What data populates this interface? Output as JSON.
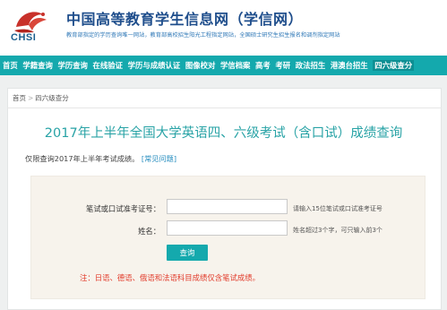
{
  "header": {
    "logo_text": "CHSI",
    "site_title": "中国高等教育学生信息网（学信网）",
    "site_subtitle": "教育部指定的学历查询唯一网站，教育部高校招生阳光工程指定网站，全国硕士研究生招生报名和调剂指定网站"
  },
  "nav": {
    "items": [
      "首页",
      "学籍查询",
      "学历查询",
      "在线验证",
      "学历与成绩认证",
      "图像校对",
      "学信档案",
      "高考",
      "考研",
      "政法招生",
      "港澳台招生",
      "四六级查分"
    ]
  },
  "breadcrumb": {
    "home": "首页",
    "separator": ">",
    "current": "四六级查分"
  },
  "main": {
    "title": "2017年上半年全国大学英语四、六级考试（含口试）成绩查询",
    "notice": "仅限查询2017年上半年考试成绩。",
    "faq_link": "[常见问题]"
  },
  "form": {
    "id_label": "笔试或口试准考证号：",
    "id_value": "",
    "id_hint": "请输入15位笔试或口试准考证号",
    "name_label": "姓名：",
    "name_value": "",
    "name_hint": "姓名超过3个字，可只输入前3个",
    "submit_label": "查询",
    "warning": "注：日语、德语、俄语和法语科目成绩仅含笔试成绩。"
  },
  "colors": {
    "brand_teal": "#14a9ad",
    "title_teal": "#29a3a6",
    "warning_red": "#e23c2c",
    "header_blue": "#1f4e8c"
  }
}
